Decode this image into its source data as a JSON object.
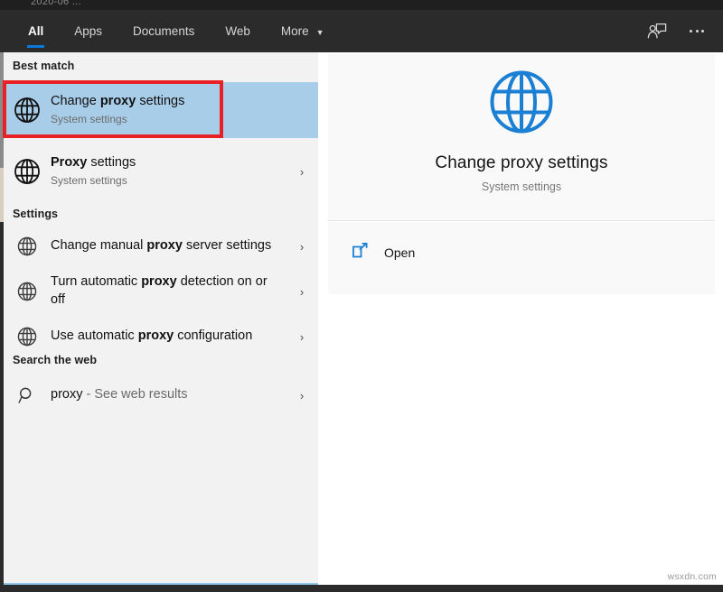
{
  "top_strip": {
    "clipped_text": "2020-06 ..."
  },
  "header": {
    "tabs": [
      {
        "label": "All",
        "active": true
      },
      {
        "label": "Apps",
        "active": false
      },
      {
        "label": "Documents",
        "active": false
      },
      {
        "label": "Web",
        "active": false
      },
      {
        "label": "More",
        "active": false,
        "caret": "▼"
      }
    ],
    "icons": [
      {
        "name": "feedback-icon",
        "label": "Feedback"
      },
      {
        "name": "more-options-icon",
        "label": "..."
      }
    ]
  },
  "left_pane": {
    "best_match": {
      "heading": "Best match",
      "item": {
        "icon": "globe-icon",
        "title_prefix": "Change ",
        "title_bold": "proxy",
        "title_suffix": " settings",
        "subtitle": "System settings",
        "selected": true,
        "highlighted_by_annotation": true
      }
    },
    "other_result": {
      "icon": "globe-icon",
      "title_bold": "Proxy",
      "title_suffix": " settings",
      "subtitle": "System settings",
      "chevron": "›"
    },
    "settings": {
      "heading": "Settings",
      "items": [
        {
          "icon": "globe-icon",
          "prefix": "Change manual ",
          "bold": "proxy",
          "suffix": " server settings",
          "chevron": "›"
        },
        {
          "icon": "globe-icon",
          "prefix": "Turn automatic ",
          "bold": "proxy",
          "suffix": " detection on or off",
          "chevron": "›"
        },
        {
          "icon": "globe-icon",
          "prefix": "Use automatic ",
          "bold": "proxy",
          "suffix": " configuration",
          "chevron": "›"
        }
      ]
    },
    "search_the_web": {
      "heading": "Search the web",
      "item": {
        "icon": "search-icon",
        "query": "proxy",
        "suffix": " - See web results",
        "chevron": "›"
      }
    }
  },
  "right_pane": {
    "icon": "globe-icon",
    "title": "Change proxy settings",
    "subtitle": "System settings",
    "actions": [
      {
        "icon": "open-external-icon",
        "label": "Open"
      }
    ]
  },
  "watermark": {
    "text": "wsxdn.com"
  },
  "colors": {
    "header_bg": "#2b2b2b",
    "accent_blue": "#0a7ad8",
    "selection_blue": "#a8cde8",
    "annotation_red": "#e82127",
    "pane_bg": "#f2f2f2",
    "preview_bg": "#f9f9f9",
    "globe_blue": "#1b7fd4"
  }
}
